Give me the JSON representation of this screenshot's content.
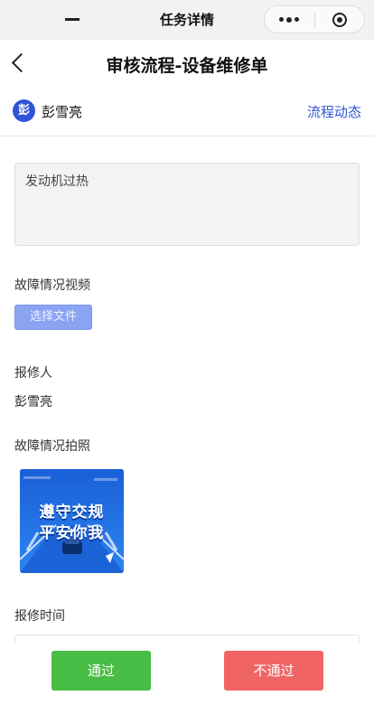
{
  "miniprogram_bar": {
    "title": "任务详情"
  },
  "navbar": {
    "title": "审核流程-设备维修单"
  },
  "user_row": {
    "avatar_char": "彭",
    "name": "彭雪亮",
    "flow_link": "流程动态"
  },
  "form": {
    "description": "发动机过热",
    "video_label": "故障情况视频",
    "choose_file_label": "选择文件",
    "reporter_label": "报修人",
    "reporter_value": "彭雪亮",
    "photo_label": "故障情况拍照",
    "photo_line_1": "遵守交规",
    "photo_line_2": "平安你我",
    "repair_time_label": "报修时间"
  },
  "actions": {
    "approve_label": "通过",
    "reject_label": "不通过"
  },
  "colors": {
    "accent": "#2f54d6",
    "file_button": "#8aa4f2",
    "approve": "#48bd45",
    "reject": "#f16466"
  }
}
